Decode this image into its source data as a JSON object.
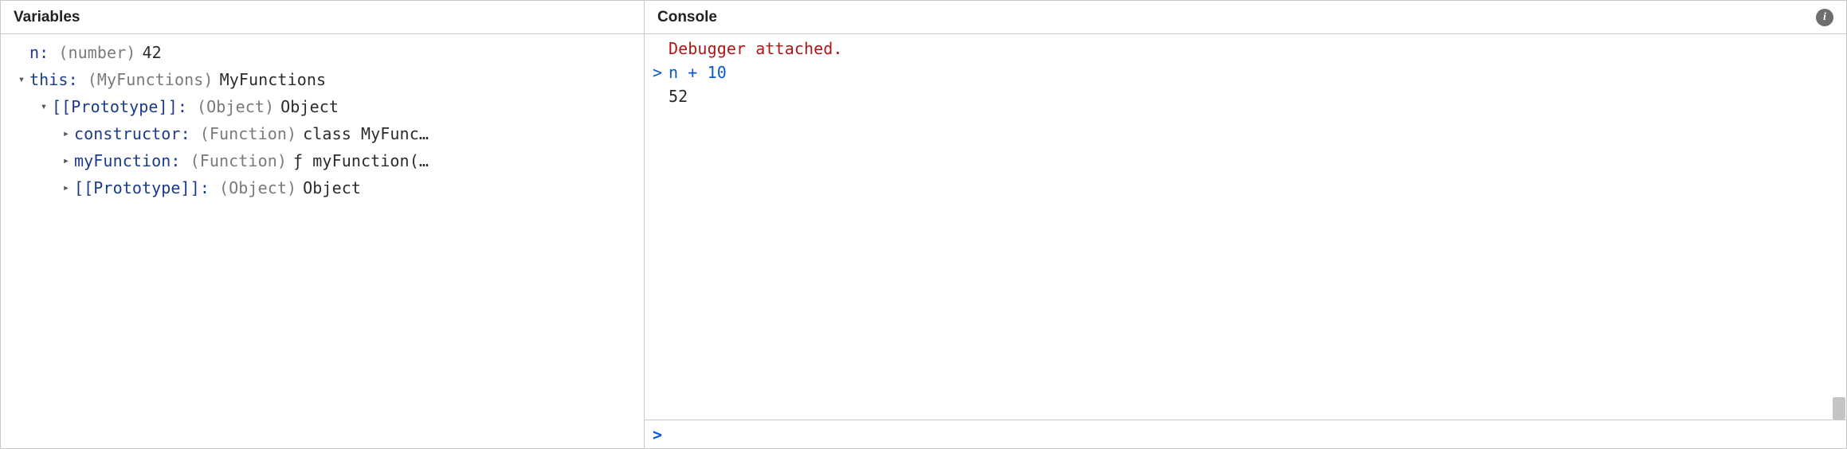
{
  "panels": {
    "variables": {
      "title": "Variables"
    },
    "console": {
      "title": "Console"
    }
  },
  "icons": {
    "chevron_down": "▾",
    "chevron_right": "▸",
    "info_glyph": "i",
    "prompt": ">"
  },
  "variables": {
    "rows": [
      {
        "indent": 1,
        "twisty": "none",
        "key": "n",
        "type": "(number)",
        "value": "42"
      },
      {
        "indent": 1,
        "twisty": "down",
        "key": "this",
        "type": "(MyFunctions)",
        "value": "MyFunctions"
      },
      {
        "indent": 2,
        "twisty": "down",
        "key": "[[Prototype]]",
        "type": "(Object)",
        "value": "Object"
      },
      {
        "indent": 3,
        "twisty": "right",
        "key": "constructor",
        "type": "(Function)",
        "value": "class MyFunc…"
      },
      {
        "indent": 3,
        "twisty": "right",
        "key": "myFunction",
        "type": "(Function)",
        "value": "ƒ myFunction(…"
      },
      {
        "indent": 3,
        "twisty": "right",
        "key": "[[Prototype]]",
        "type": "(Object)",
        "value": "Object"
      }
    ]
  },
  "console": {
    "lines": [
      {
        "kind": "system",
        "gutter": "",
        "text": "Debugger attached."
      },
      {
        "kind": "input",
        "gutter": ">",
        "text": "n + 10"
      },
      {
        "kind": "output",
        "gutter": "",
        "text": "52"
      }
    ],
    "input_value": ""
  }
}
